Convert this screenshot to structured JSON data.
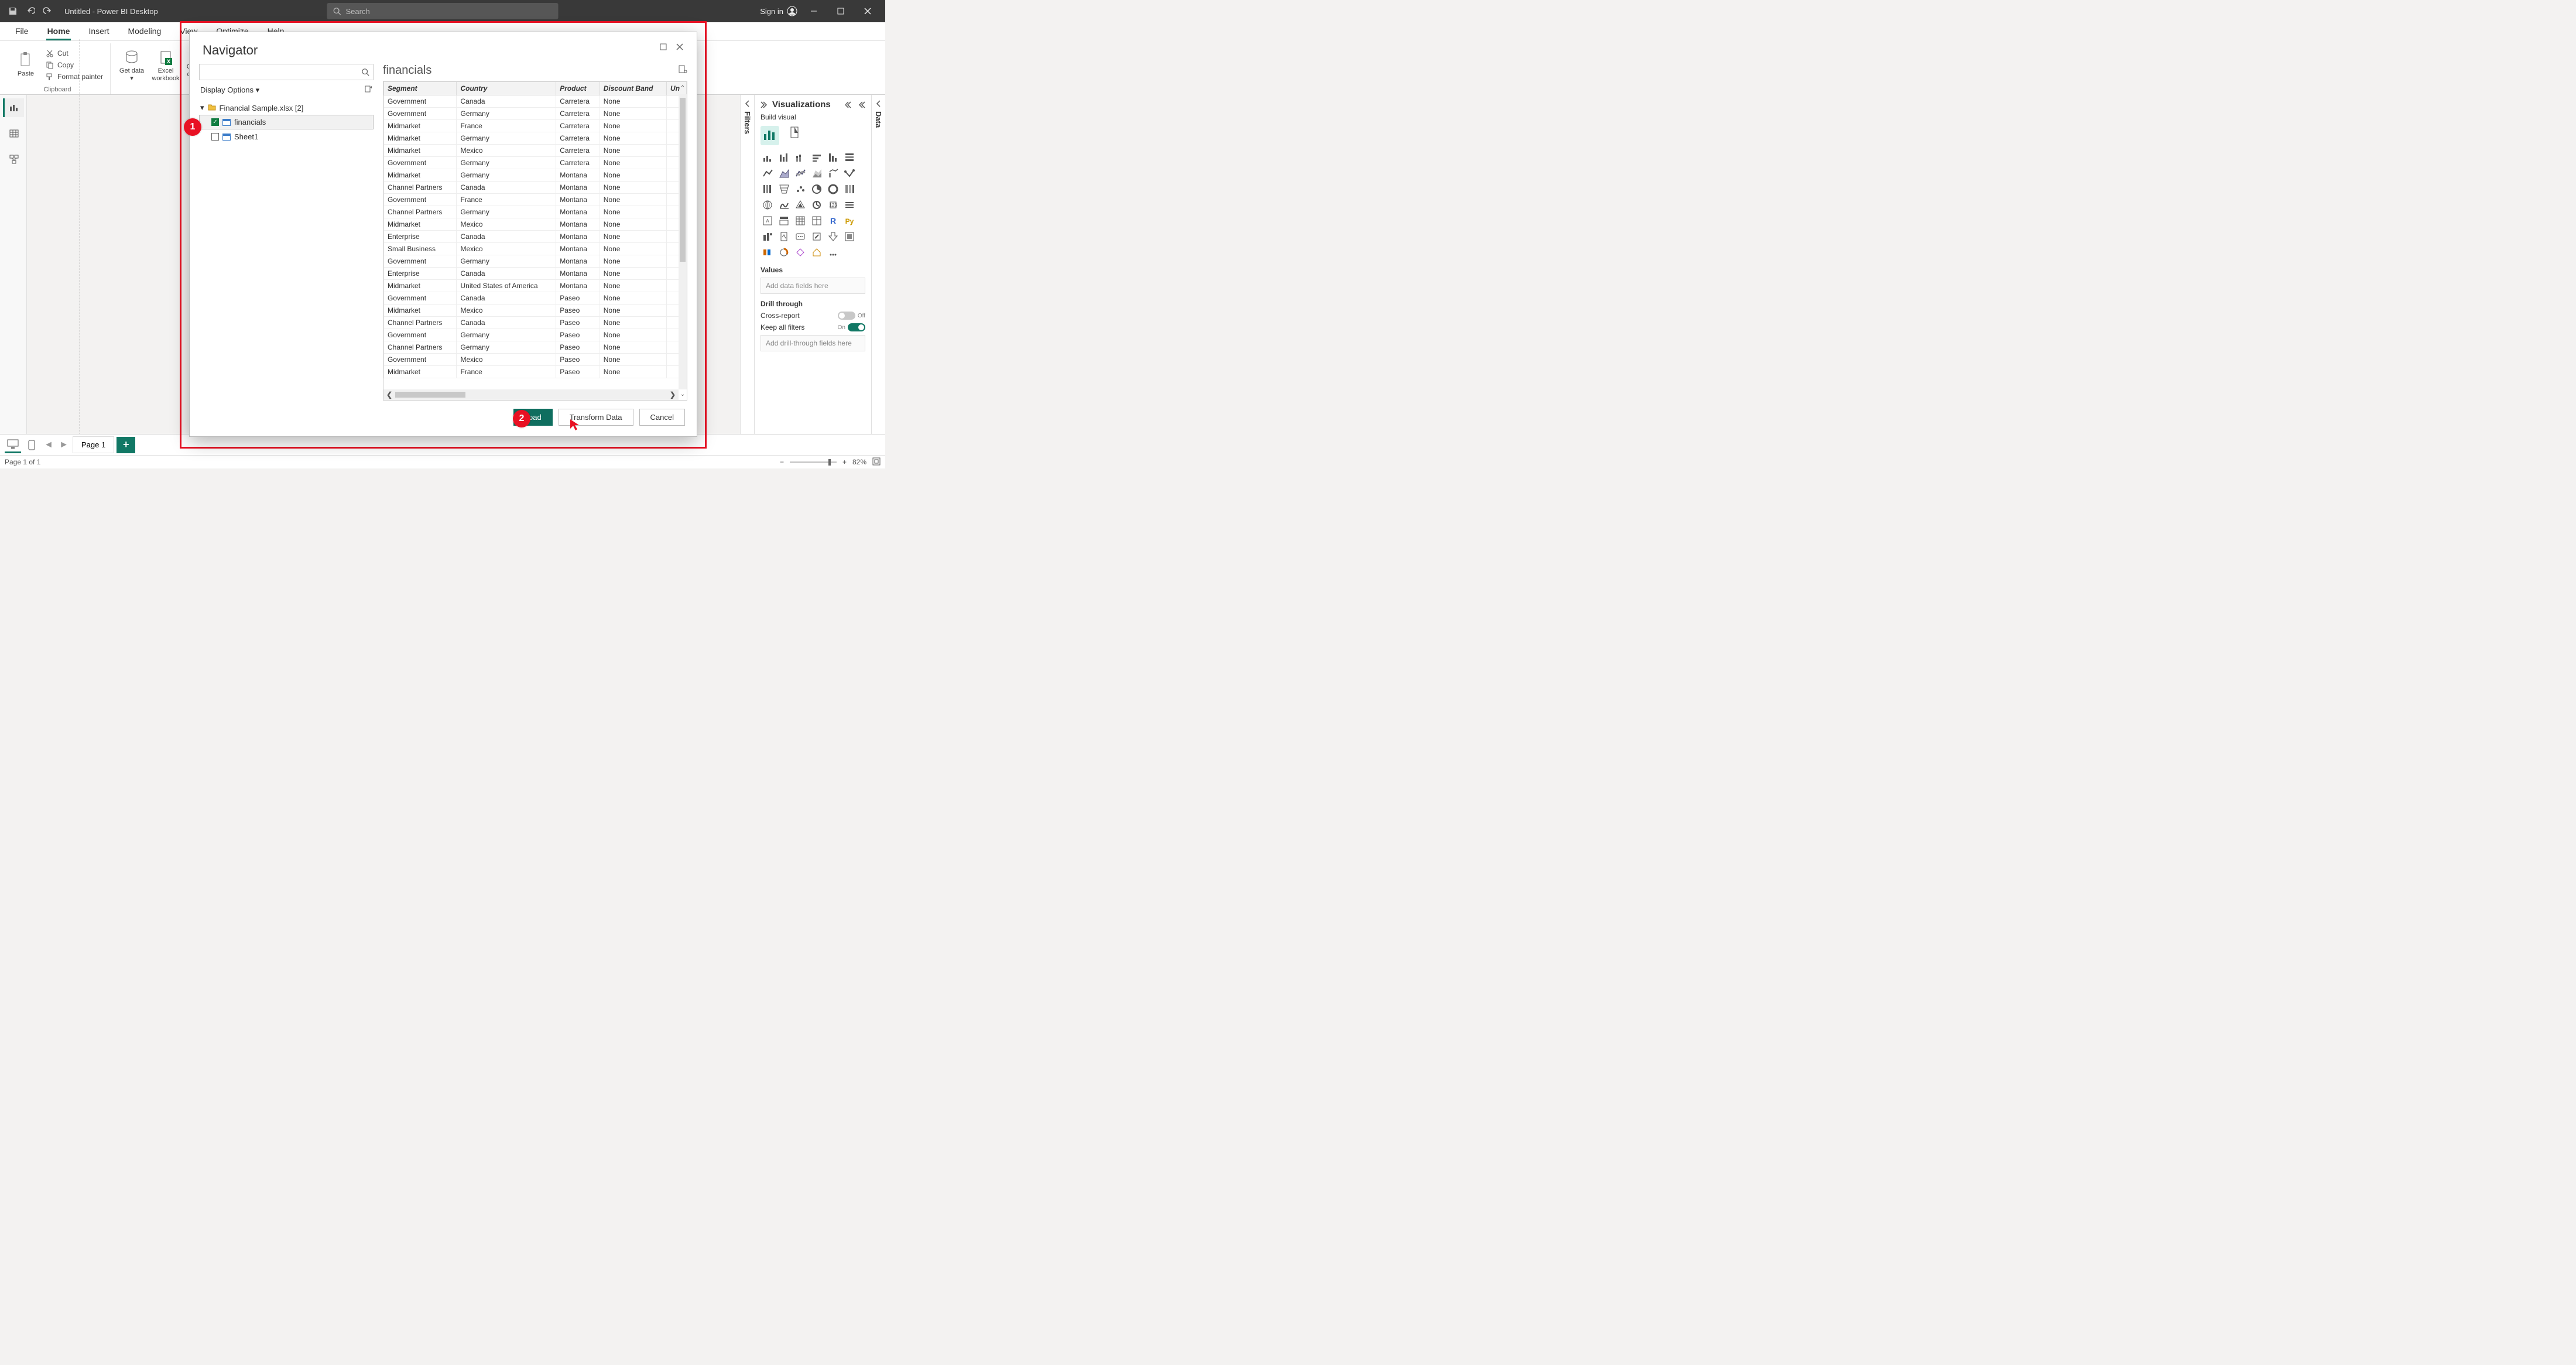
{
  "titlebar": {
    "title": "Untitled - Power BI Desktop",
    "search_placeholder": "Search",
    "signin": "Sign in"
  },
  "menu": {
    "items": [
      "File",
      "Home",
      "Insert",
      "Modeling",
      "View",
      "Optimize",
      "Help"
    ],
    "active": "Home"
  },
  "ribbon": {
    "paste": "Paste",
    "cut": "Cut",
    "copy": "Copy",
    "format_painter": "Format painter",
    "clipboard": "Clipboard",
    "get_data": "Get data",
    "excel": "Excel workbook",
    "onelake": "OneLake data hub"
  },
  "leftrail": {
    "report": "Report",
    "data": "Data",
    "model": "Model"
  },
  "viz": {
    "title": "Visualizations",
    "build": "Build visual",
    "values": "Values",
    "values_placeholder": "Add data fields here",
    "drill": "Drill through",
    "cross": "Cross-report",
    "keep": "Keep all filters",
    "drill_placeholder": "Add drill-through fields here",
    "toggle_off": "Off",
    "toggle_on": "On"
  },
  "filters_label": "Filters",
  "data_label": "Data",
  "pages": {
    "page1": "Page 1"
  },
  "status": {
    "pageinfo": "Page 1 of 1",
    "zoom": "82%"
  },
  "dialog": {
    "title": "Navigator",
    "display_options": "Display Options",
    "file": "Financial Sample.xlsx [2]",
    "items": [
      {
        "name": "financials",
        "checked": true
      },
      {
        "name": "Sheet1",
        "checked": false
      }
    ],
    "preview_title": "financials",
    "columns": [
      "Segment",
      "Country",
      "Product",
      "Discount Band",
      "Un"
    ],
    "rows": [
      [
        "Government",
        "Canada",
        "Carretera",
        "None"
      ],
      [
        "Government",
        "Germany",
        "Carretera",
        "None"
      ],
      [
        "Midmarket",
        "France",
        "Carretera",
        "None"
      ],
      [
        "Midmarket",
        "Germany",
        "Carretera",
        "None"
      ],
      [
        "Midmarket",
        "Mexico",
        "Carretera",
        "None"
      ],
      [
        "Government",
        "Germany",
        "Carretera",
        "None"
      ],
      [
        "Midmarket",
        "Germany",
        "Montana",
        "None"
      ],
      [
        "Channel Partners",
        "Canada",
        "Montana",
        "None"
      ],
      [
        "Government",
        "France",
        "Montana",
        "None"
      ],
      [
        "Channel Partners",
        "Germany",
        "Montana",
        "None"
      ],
      [
        "Midmarket",
        "Mexico",
        "Montana",
        "None"
      ],
      [
        "Enterprise",
        "Canada",
        "Montana",
        "None"
      ],
      [
        "Small Business",
        "Mexico",
        "Montana",
        "None"
      ],
      [
        "Government",
        "Germany",
        "Montana",
        "None"
      ],
      [
        "Enterprise",
        "Canada",
        "Montana",
        "None"
      ],
      [
        "Midmarket",
        "United States of America",
        "Montana",
        "None"
      ],
      [
        "Government",
        "Canada",
        "Paseo",
        "None"
      ],
      [
        "Midmarket",
        "Mexico",
        "Paseo",
        "None"
      ],
      [
        "Channel Partners",
        "Canada",
        "Paseo",
        "None"
      ],
      [
        "Government",
        "Germany",
        "Paseo",
        "None"
      ],
      [
        "Channel Partners",
        "Germany",
        "Paseo",
        "None"
      ],
      [
        "Government",
        "Mexico",
        "Paseo",
        "None"
      ],
      [
        "Midmarket",
        "France",
        "Paseo",
        "None"
      ]
    ],
    "buttons": {
      "load": "Load",
      "transform": "Transform Data",
      "cancel": "Cancel"
    }
  },
  "annotations": {
    "b1": "1",
    "b2": "2"
  }
}
